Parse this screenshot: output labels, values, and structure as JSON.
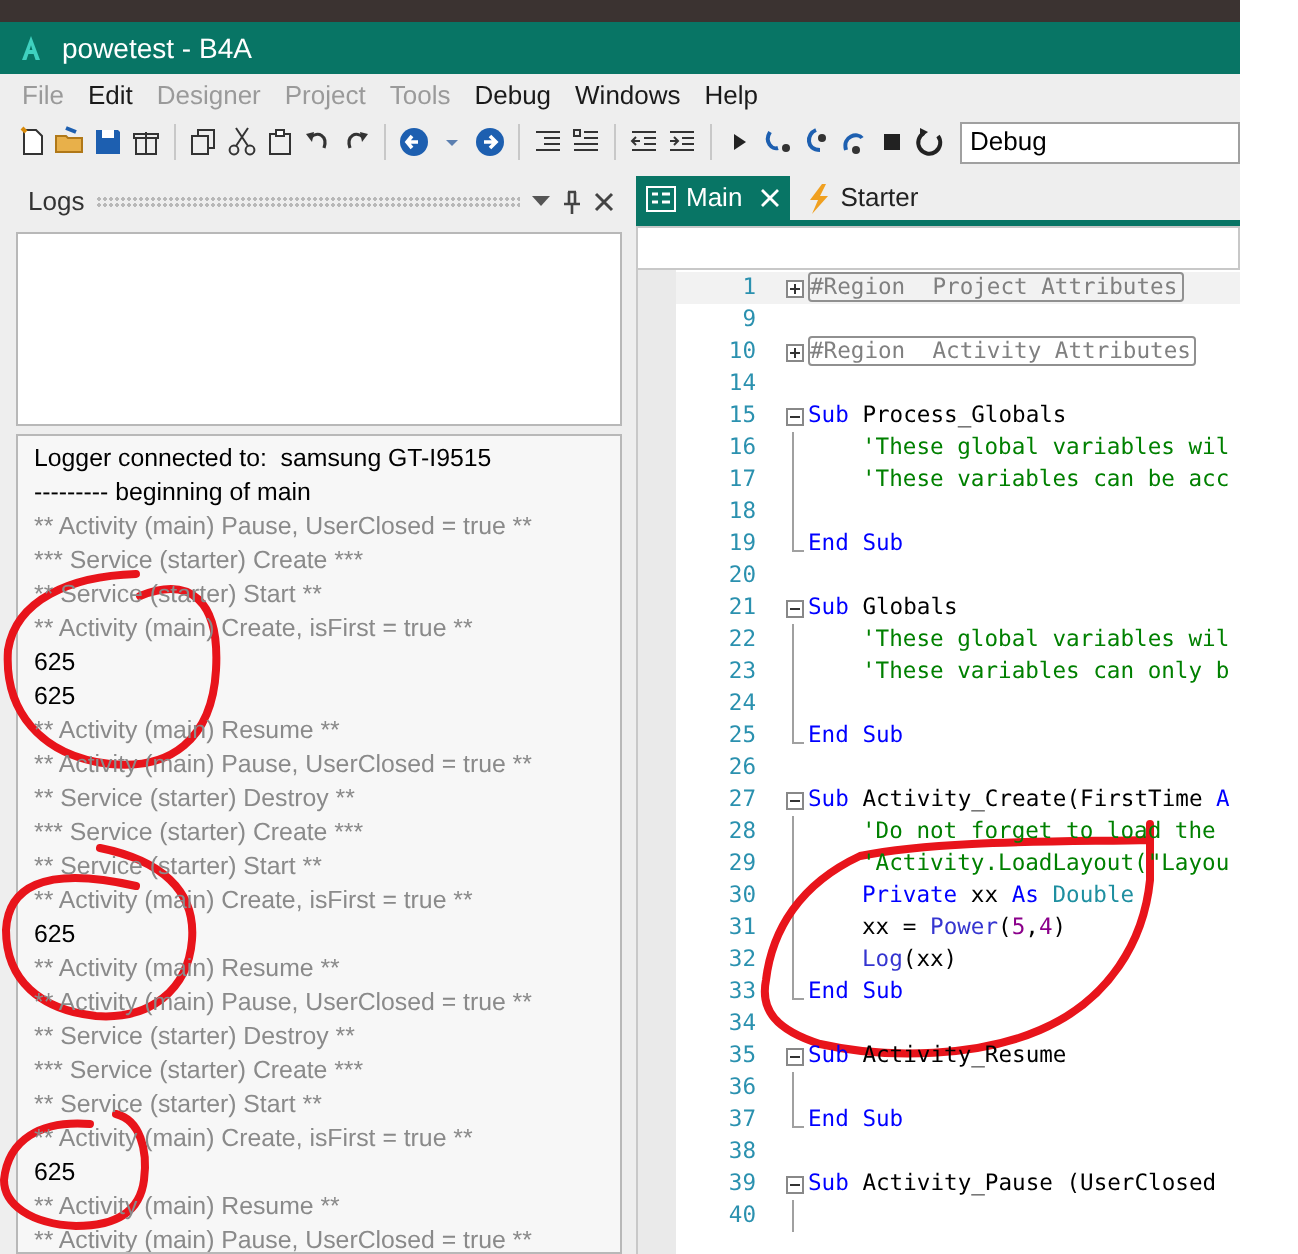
{
  "window": {
    "title": "powetest - B4A"
  },
  "menu": [
    {
      "label": "File",
      "disabled": true
    },
    {
      "label": "Edit",
      "disabled": false
    },
    {
      "label": "Designer",
      "disabled": true
    },
    {
      "label": "Project",
      "disabled": true
    },
    {
      "label": "Tools",
      "disabled": true
    },
    {
      "label": "Debug",
      "disabled": false
    },
    {
      "label": "Windows",
      "disabled": false
    },
    {
      "label": "Help",
      "disabled": false
    }
  ],
  "toolbar": {
    "build_config": {
      "value": "Debug"
    }
  },
  "logs_panel": {
    "title": "Logs",
    "lines": [
      {
        "kind": "output",
        "text": "Logger connected to:  samsung GT-I9515"
      },
      {
        "kind": "output",
        "text": "--------- beginning of main"
      },
      {
        "kind": "system",
        "text": "** Activity (main) Pause, UserClosed = true **"
      },
      {
        "kind": "system",
        "text": "*** Service (starter) Create ***"
      },
      {
        "kind": "system",
        "text": "** Service (starter) Start **"
      },
      {
        "kind": "system",
        "text": "** Activity (main) Create, isFirst = true **"
      },
      {
        "kind": "output",
        "text": "625"
      },
      {
        "kind": "output",
        "text": "625"
      },
      {
        "kind": "system",
        "text": "** Activity (main) Resume **"
      },
      {
        "kind": "system",
        "text": "** Activity (main) Pause, UserClosed = true **"
      },
      {
        "kind": "system",
        "text": "** Service (starter) Destroy **"
      },
      {
        "kind": "system",
        "text": "*** Service (starter) Create ***"
      },
      {
        "kind": "system",
        "text": "** Service (starter) Start **"
      },
      {
        "kind": "system",
        "text": "** Activity (main) Create, isFirst = true **"
      },
      {
        "kind": "output",
        "text": "625"
      },
      {
        "kind": "system",
        "text": "** Activity (main) Resume **"
      },
      {
        "kind": "system",
        "text": "** Activity (main) Pause, UserClosed = true **"
      },
      {
        "kind": "system",
        "text": "** Service (starter) Destroy **"
      },
      {
        "kind": "system",
        "text": "*** Service (starter) Create ***"
      },
      {
        "kind": "system",
        "text": "** Service (starter) Start **"
      },
      {
        "kind": "system",
        "text": "** Activity (main) Create, isFirst = true **"
      },
      {
        "kind": "output",
        "text": "625"
      },
      {
        "kind": "system",
        "text": "** Activity (main) Resume **"
      },
      {
        "kind": "system",
        "text": "** Activity (main) Pause, UserClosed = true **"
      }
    ]
  },
  "editor_tabs": [
    {
      "label": "Main",
      "selected": true
    },
    {
      "label": "Starter",
      "selected": false
    }
  ],
  "code_lines": [
    {
      "number": "1",
      "kind": "region",
      "current": true,
      "segments": [
        {
          "kind": "region",
          "text": "#Region  Project Attributes"
        }
      ]
    },
    {
      "number": "9",
      "kind": "plain",
      "current": false
    },
    {
      "number": "10",
      "kind": "region",
      "current": false,
      "segments": [
        {
          "kind": "region",
          "text": "#Region  Activity Attributes"
        }
      ]
    },
    {
      "number": "14",
      "kind": "plain",
      "current": false
    },
    {
      "number": "15",
      "kind": "sub_start",
      "current": false,
      "segments": [
        {
          "kind": "keyword",
          "text": "Sub"
        },
        {
          "kind": "plain",
          "text": " Process_Globals"
        }
      ]
    },
    {
      "number": "16",
      "kind": "sub_body",
      "current": false,
      "segments": [
        {
          "kind": "comment",
          "text": "'These global variables wil"
        }
      ]
    },
    {
      "number": "17",
      "kind": "sub_body",
      "current": false,
      "segments": [
        {
          "kind": "comment",
          "text": "'These variables can be acc"
        }
      ]
    },
    {
      "number": "18",
      "kind": "sub_body",
      "current": false
    },
    {
      "number": "19",
      "kind": "sub_end",
      "current": false,
      "segments": [
        {
          "kind": "keyword",
          "text": "End Sub"
        }
      ]
    },
    {
      "number": "20",
      "kind": "plain",
      "current": false
    },
    {
      "number": "21",
      "kind": "sub_start",
      "current": false,
      "segments": [
        {
          "kind": "keyword",
          "text": "Sub"
        },
        {
          "kind": "plain",
          "text": " Globals"
        }
      ]
    },
    {
      "number": "22",
      "kind": "sub_body",
      "current": false,
      "segments": [
        {
          "kind": "comment",
          "text": "'These global variables wil"
        }
      ]
    },
    {
      "number": "23",
      "kind": "sub_body",
      "current": false,
      "segments": [
        {
          "kind": "comment",
          "text": "'These variables can only b"
        }
      ]
    },
    {
      "number": "24",
      "kind": "sub_body",
      "current": false
    },
    {
      "number": "25",
      "kind": "sub_end",
      "current": false,
      "segments": [
        {
          "kind": "keyword",
          "text": "End Sub"
        }
      ]
    },
    {
      "number": "26",
      "kind": "plain",
      "current": false
    },
    {
      "number": "27",
      "kind": "sub_start",
      "current": false,
      "segments": [
        {
          "kind": "keyword",
          "text": "Sub"
        },
        {
          "kind": "plain",
          "text": " Activity_Create(FirstTime "
        },
        {
          "kind": "keyword",
          "text": "A"
        }
      ]
    },
    {
      "number": "28",
      "kind": "sub_body",
      "current": false,
      "segments": [
        {
          "kind": "comment",
          "text": "'Do not forget to load the"
        }
      ]
    },
    {
      "number": "29",
      "kind": "sub_body",
      "current": false,
      "segments": [
        {
          "kind": "comment",
          "text": "'Activity.LoadLayout(\"Layou"
        }
      ]
    },
    {
      "number": "30",
      "kind": "sub_body",
      "current": false,
      "segments": [
        {
          "kind": "keyword",
          "text": "Private"
        },
        {
          "kind": "plain",
          "text": " xx "
        },
        {
          "kind": "keyword",
          "text": "As"
        },
        {
          "kind": "type",
          "text": " Double"
        }
      ]
    },
    {
      "number": "31",
      "kind": "sub_body",
      "current": false,
      "segments": [
        {
          "kind": "plain",
          "text": "xx = "
        },
        {
          "kind": "function",
          "text": "Power"
        },
        {
          "kind": "plain",
          "text": "("
        },
        {
          "kind": "number",
          "text": "5"
        },
        {
          "kind": "plain",
          "text": ","
        },
        {
          "kind": "number",
          "text": "4"
        },
        {
          "kind": "plain",
          "text": ")"
        }
      ]
    },
    {
      "number": "32",
      "kind": "sub_body",
      "current": false,
      "segments": [
        {
          "kind": "function",
          "text": "Log"
        },
        {
          "kind": "plain",
          "text": "(xx)"
        }
      ]
    },
    {
      "number": "33",
      "kind": "sub_end",
      "current": false,
      "segments": [
        {
          "kind": "keyword",
          "text": "End Sub"
        }
      ]
    },
    {
      "number": "34",
      "kind": "plain",
      "current": false
    },
    {
      "number": "35",
      "kind": "sub_start",
      "current": false,
      "segments": [
        {
          "kind": "keyword",
          "text": "Sub"
        },
        {
          "kind": "plain",
          "text": " Activity_Resume"
        }
      ]
    },
    {
      "number": "36",
      "kind": "sub_body",
      "current": false
    },
    {
      "number": "37",
      "kind": "sub_end",
      "current": false,
      "segments": [
        {
          "kind": "keyword",
          "text": "End Sub"
        }
      ]
    },
    {
      "number": "38",
      "kind": "plain",
      "current": false
    },
    {
      "number": "39",
      "kind": "sub_start",
      "current": false,
      "segments": [
        {
          "kind": "keyword",
          "text": "Sub"
        },
        {
          "kind": "plain",
          "text": " Activity_Pause (UserClosed"
        }
      ]
    },
    {
      "number": "40",
      "kind": "sub_body",
      "current": false
    }
  ]
}
